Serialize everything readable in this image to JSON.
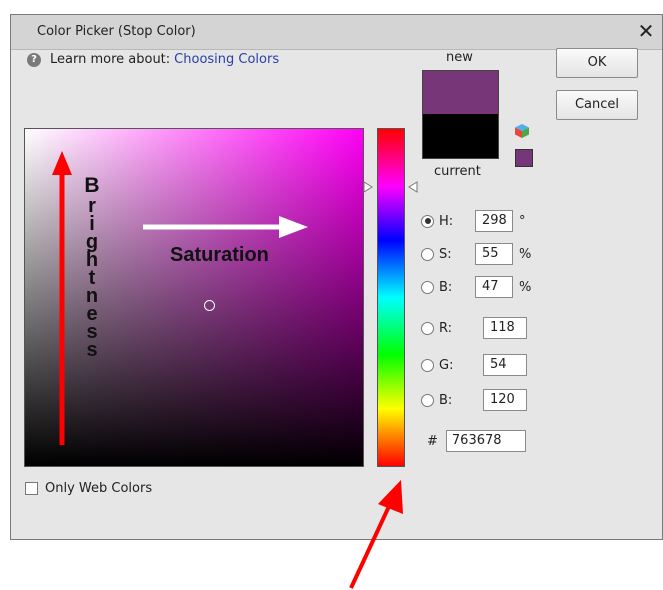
{
  "window": {
    "title": "Color Picker (Stop Color)",
    "close_glyph": "✕"
  },
  "help": {
    "text": "Learn more about:",
    "link": "Choosing Colors",
    "icon": "help-circle-icon"
  },
  "field": {
    "annotation_vertical": "Brightness",
    "annotation_vertical_letters": [
      "B",
      "r",
      "i",
      "g",
      "h",
      "t",
      "n",
      "e",
      "s",
      "s"
    ],
    "annotation_horizontal": "Saturation"
  },
  "swatch": {
    "new_label": "new",
    "current_label": "current",
    "new_color": "#763678",
    "current_color": "#000000"
  },
  "buttons": {
    "ok": "OK",
    "cancel": "Cancel"
  },
  "fields": {
    "h": {
      "label": "H:",
      "value": "298",
      "unit": "°",
      "selected": true
    },
    "s": {
      "label": "S:",
      "value": "55",
      "unit": "%"
    },
    "bri": {
      "label": "B:",
      "value": "47",
      "unit": "%"
    },
    "r": {
      "label": "R:",
      "value": "118"
    },
    "g": {
      "label": "G:",
      "value": "54"
    },
    "b": {
      "label": "B:",
      "value": "120"
    },
    "hex": {
      "label": "#",
      "value": "763678"
    }
  },
  "web_colors": {
    "label": "Only Web Colors",
    "checked": false
  },
  "colors": {
    "annotation_red": "#ff0000",
    "annotation_white": "#ffffff"
  }
}
